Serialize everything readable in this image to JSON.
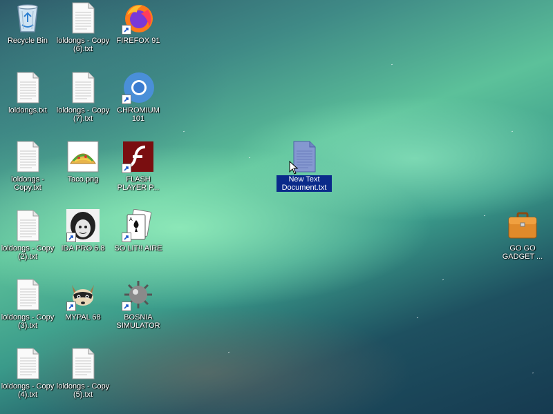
{
  "desktop": {
    "icons": [
      {
        "label": "Recycle Bin",
        "icon": "recycle-bin-icon",
        "shortcut": false
      },
      {
        "label": "loldongs - Copy (6).txt",
        "icon": "text-file-icon",
        "shortcut": false
      },
      {
        "label": "FIREFOX 91",
        "icon": "firefox-icon",
        "shortcut": true
      },
      {
        "label": "loldongs.txt",
        "icon": "text-file-icon",
        "shortcut": false
      },
      {
        "label": "loldongs - Copy (7).txt",
        "icon": "text-file-icon",
        "shortcut": false
      },
      {
        "label": "CHROMIUM 101",
        "icon": "chromium-icon",
        "shortcut": true
      },
      {
        "label": "loldongs - Copy.txt",
        "icon": "text-file-icon",
        "shortcut": false
      },
      {
        "label": "Taco.png",
        "icon": "taco-image-icon",
        "shortcut": false
      },
      {
        "label": "FLASH PLAYER P...",
        "icon": "flash-player-icon",
        "shortcut": true
      },
      {
        "label": "loldongs - Copy (2).txt",
        "icon": "text-file-icon",
        "shortcut": false
      },
      {
        "label": "IDA PRO 6.8",
        "icon": "ida-pro-icon",
        "shortcut": true
      },
      {
        "label": "SO LIT!! AIRE",
        "icon": "solitaire-icon",
        "shortcut": true
      },
      {
        "label": "loldongs - Copy (3).txt",
        "icon": "text-file-icon",
        "shortcut": false
      },
      {
        "label": "MYPAL 68",
        "icon": "mypal-raccoon-icon",
        "shortcut": true
      },
      {
        "label": "BOSNIA SIMULATOR",
        "icon": "minesweeper-mine-icon",
        "shortcut": true
      },
      {
        "label": "loldongs - Copy (4).txt",
        "icon": "text-file-icon",
        "shortcut": false
      },
      {
        "label": "loldongs - Copy (5).txt",
        "icon": "text-file-icon",
        "shortcut": false
      },
      {
        "label": "New Text Document.txt",
        "icon": "text-file-icon",
        "shortcut": false,
        "selected": true
      },
      {
        "label": "GO GO GADGET ...",
        "icon": "briefcase-icon",
        "shortcut": false
      }
    ]
  },
  "colors": {
    "selection": "#0a2a8a",
    "label_text": "#ffffff"
  }
}
